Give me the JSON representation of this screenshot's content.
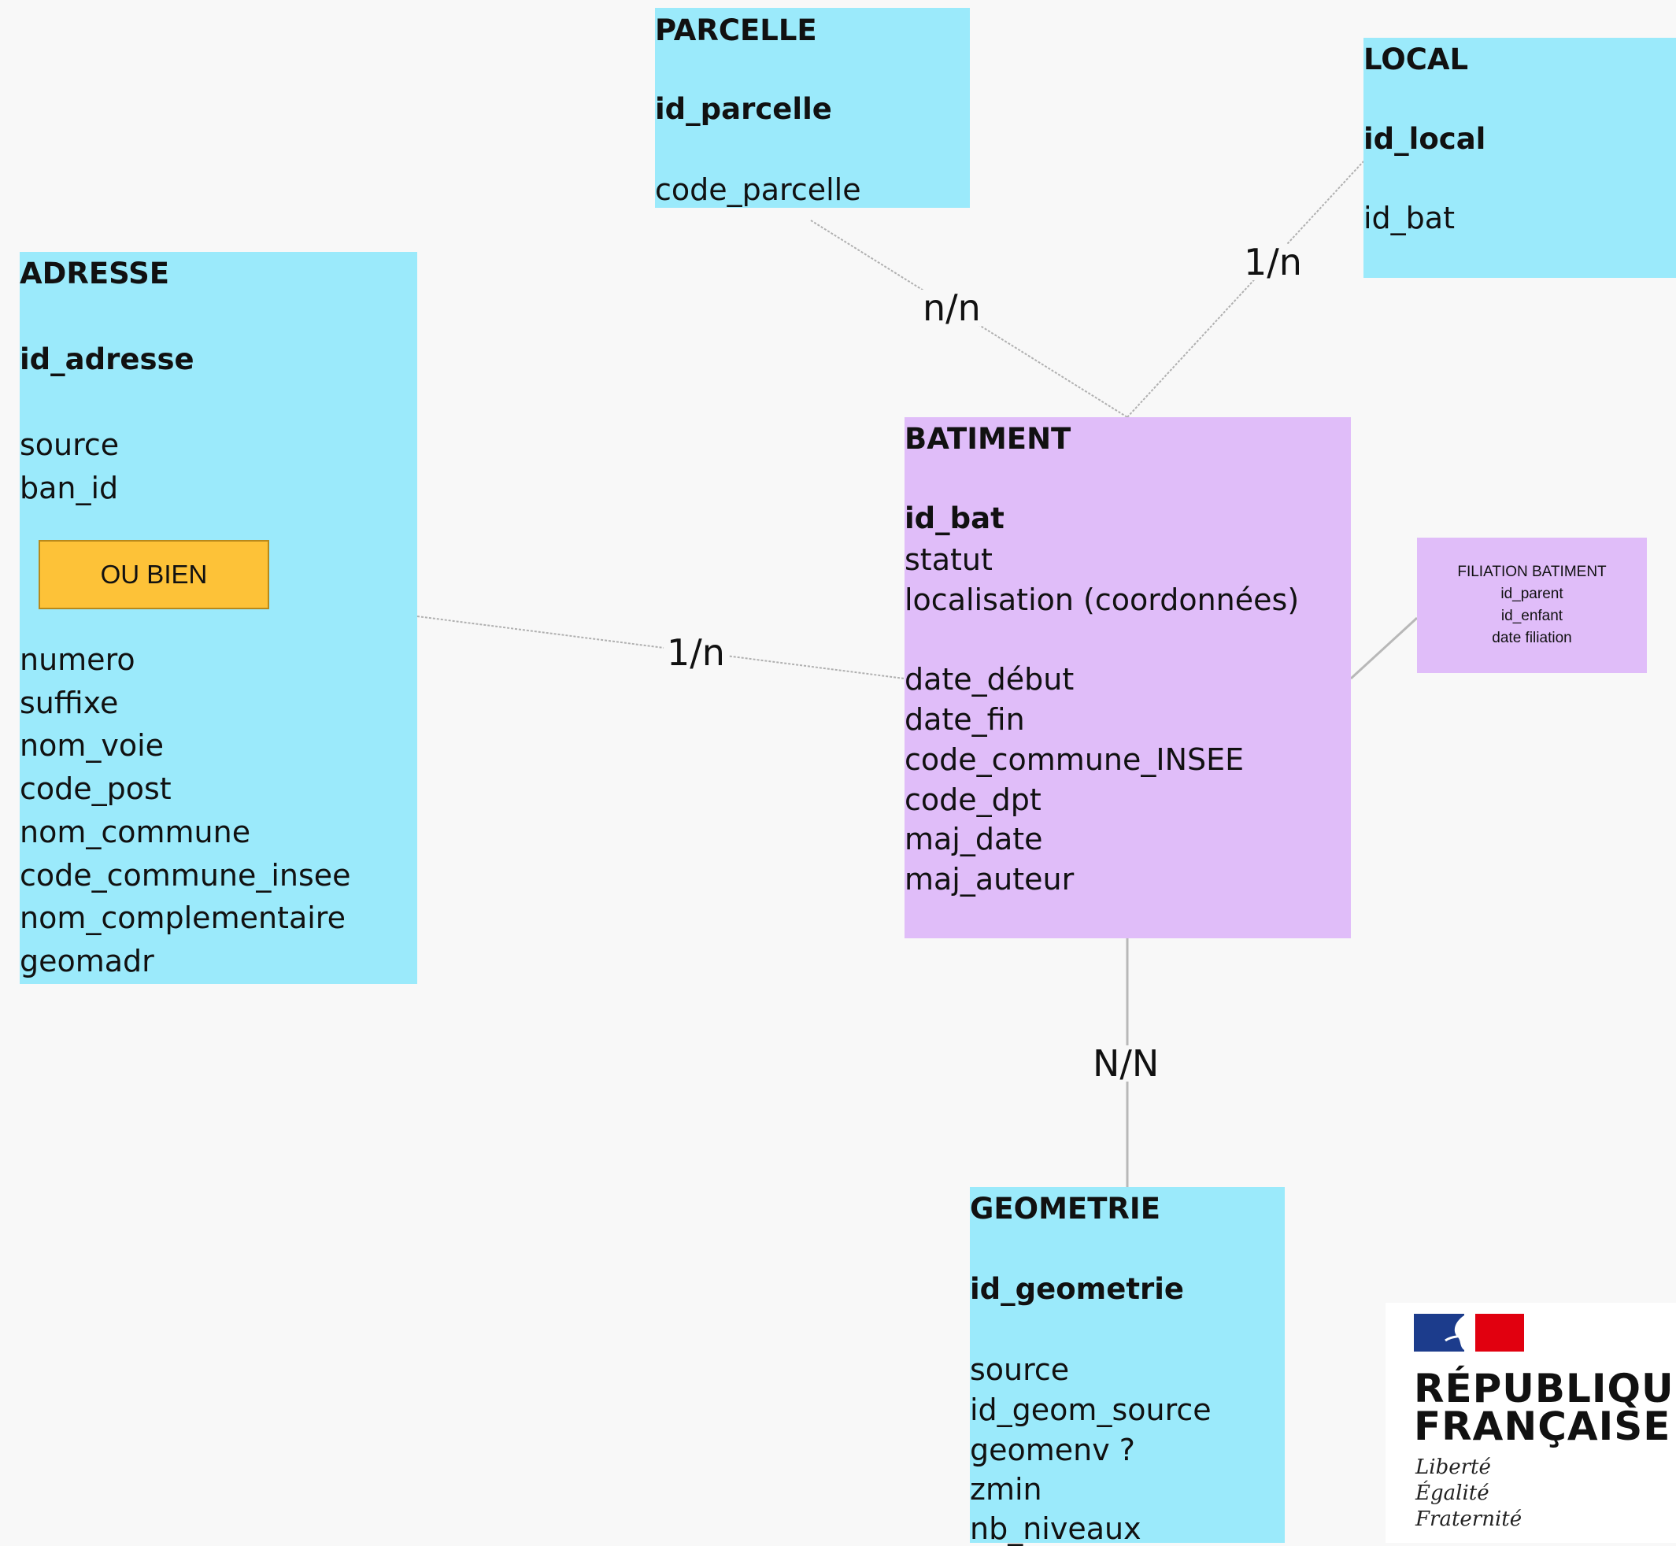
{
  "colors": {
    "entity": "#9beafb",
    "batiment": "#e0bdf9",
    "option": "#fdc238",
    "background": "#f8f8f8"
  },
  "entities": {
    "parcelle": {
      "title": "PARCELLE",
      "pk": "id_parcelle",
      "fields": [
        "code_parcelle"
      ]
    },
    "local": {
      "title": "LOCAL",
      "pk": "id_local",
      "fields": [
        "id_bat"
      ]
    },
    "adresse": {
      "title": "ADRESSE",
      "pk": "id_adresse",
      "fields_top": [
        "source",
        "ban_id"
      ],
      "option_label": "OU BIEN",
      "fields_bottom": [
        "numero",
        "suffixe",
        "nom_voie",
        "code_post",
        "nom_commune",
        "code_commune_insee",
        "nom_complementaire",
        "geomadr"
      ]
    },
    "batiment": {
      "title": "BATIMENT",
      "pk": "id_bat",
      "fields_top": [
        "statut",
        "localisation (coordonnées)"
      ],
      "fields_bottom": [
        "date_début",
        "date_fin",
        "code_commune_INSEE",
        "code_dpt",
        "maj_date",
        "maj_auteur"
      ]
    },
    "geometrie": {
      "title": "GEOMETRIE",
      "pk": "id_geometrie",
      "fields": [
        "source",
        "id_geom_source",
        "geomenv ?",
        "zmin",
        "nb_niveaux"
      ]
    },
    "filiation": {
      "lines": [
        "FILIATION BATIMENT",
        "id_parent",
        "id_enfant",
        "date filiation"
      ]
    }
  },
  "relations": {
    "parcelle_batiment": "n/n",
    "local_batiment": "1/n",
    "adresse_batiment": "1/n",
    "batiment_geometrie": "N/N"
  },
  "logo": {
    "line1": "RÉPUBLIQUE",
    "line2": "FRANÇAISE",
    "motto": [
      "Liberté",
      "Égalité",
      "Fraternité"
    ]
  }
}
